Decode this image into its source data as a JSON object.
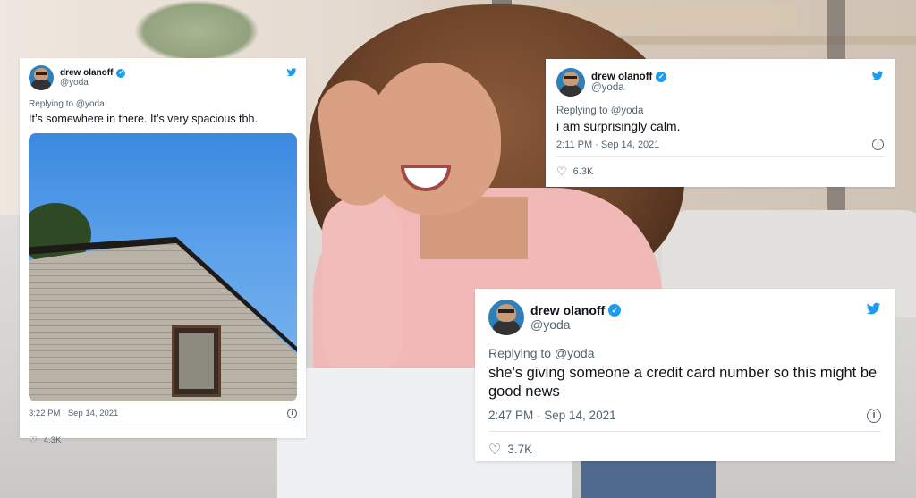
{
  "tweets": [
    {
      "author_name": "drew olanoff",
      "handle": "@yoda",
      "replying_to": "Replying to @yoda",
      "text": "It’s somewhere in there. It’s very spacious tbh.",
      "timestamp": "3:22 PM · Sep 14, 2021",
      "likes": "4.3K",
      "has_photo": true
    },
    {
      "author_name": "drew olanoff",
      "handle": "@yoda",
      "replying_to": "Replying to @yoda",
      "text": "i am surprisingly calm.",
      "timestamp": "2:11 PM · Sep 14, 2021",
      "likes": "6.3K",
      "has_photo": false
    },
    {
      "author_name": "drew olanoff",
      "handle": "@yoda",
      "replying_to": "Replying to @yoda",
      "text": "she's giving someone a credit card number so this might be good news",
      "timestamp": "2:47 PM · Sep 14, 2021",
      "likes": "3.7K",
      "has_photo": false
    }
  ],
  "icons": {
    "verified": "verified-badge-icon",
    "bird": "twitter-bird-icon",
    "info": "info-icon",
    "heart": "heart-icon"
  },
  "colors": {
    "twitter_blue": "#1d9bf0",
    "secondary_text": "#536471"
  }
}
